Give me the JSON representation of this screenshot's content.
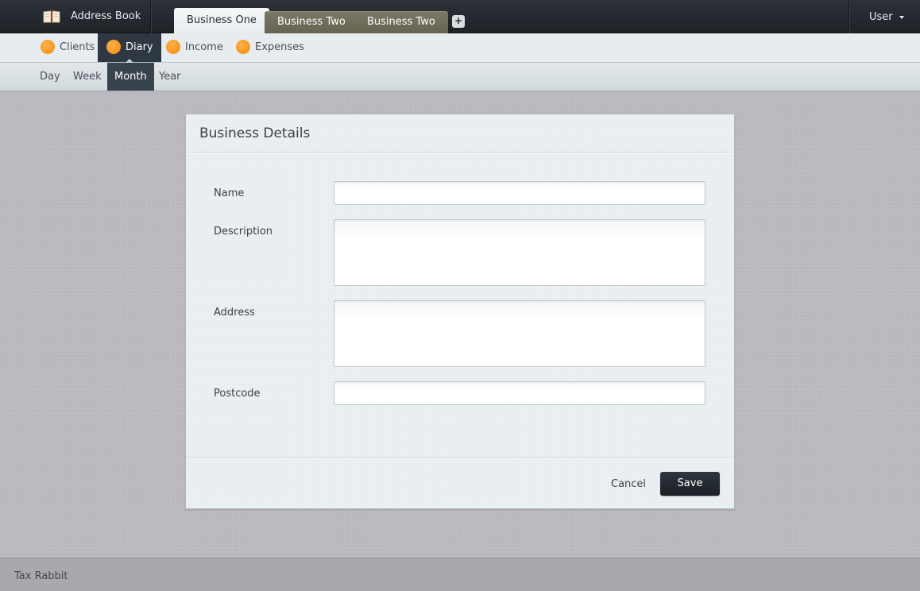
{
  "app": {
    "title": "Address Book",
    "user_label": "User"
  },
  "tabs": [
    {
      "label": "Business One",
      "active": true
    },
    {
      "label": "Business Two",
      "active": false
    },
    {
      "label": "Business Two",
      "active": false
    }
  ],
  "add_tab_symbol": "+",
  "main_nav": [
    {
      "label": "Clients",
      "active": false
    },
    {
      "label": "Diary",
      "active": true
    },
    {
      "label": "Income",
      "active": false
    },
    {
      "label": "Expenses",
      "active": false
    }
  ],
  "sub_nav": [
    {
      "label": "Day",
      "active": false
    },
    {
      "label": "Week",
      "active": false
    },
    {
      "label": "Month",
      "active": true
    },
    {
      "label": "Year",
      "active": false
    }
  ],
  "form": {
    "title": "Business Details",
    "fields": [
      {
        "label": "Name",
        "value": ""
      },
      {
        "label": "Description",
        "value": ""
      },
      {
        "label": "Address",
        "value": ""
      },
      {
        "label": "Postcode",
        "value": ""
      }
    ],
    "cancel_label": "Cancel",
    "save_label": "Save"
  },
  "footer": {
    "text": "Tax Rabbit"
  },
  "colors": {
    "accent": "#f28a0c",
    "topbar": "#23272d",
    "nav_active": "#2d3842",
    "save_button": "#1f242a"
  }
}
